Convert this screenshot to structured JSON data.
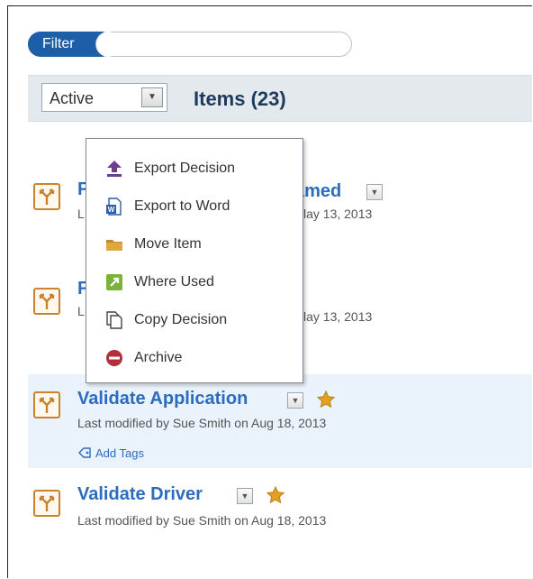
{
  "filter": {
    "label": "Filter",
    "placeholder": ""
  },
  "toolbar": {
    "status": "Active",
    "items_title": "Items (23)"
  },
  "context_menu": {
    "items": [
      {
        "label": "Export Decision",
        "icon": "export-decision-icon"
      },
      {
        "label": "Export to Word",
        "icon": "word-icon"
      },
      {
        "label": "Move Item",
        "icon": "folder-icon"
      },
      {
        "label": "Where Used",
        "icon": "where-used-icon"
      },
      {
        "label": "Copy Decision",
        "icon": "copy-icon"
      },
      {
        "label": "Archive",
        "icon": "archive-icon"
      }
    ]
  },
  "items": [
    {
      "title_start": "F",
      "title_end": "amed",
      "meta_start": "L",
      "meta_end": "lay 13, 2013"
    },
    {
      "title_start": "F",
      "meta_start": "L",
      "meta_end": "lay 13, 2013"
    },
    {
      "title": "Validate Application",
      "meta": "Last modified by Sue Smith on Aug 18, 2013",
      "add_tags": "Add Tags",
      "starred": true
    },
    {
      "title": "Validate Driver",
      "meta": "Last modified by Sue Smith on Aug 18, 2013",
      "starred": true
    }
  ],
  "colors": {
    "accent": "#1d5ea8",
    "link": "#2b6cc0",
    "icon_border": "#c9832c",
    "star": "#e0a020",
    "highlight": "#eaf2fb"
  }
}
